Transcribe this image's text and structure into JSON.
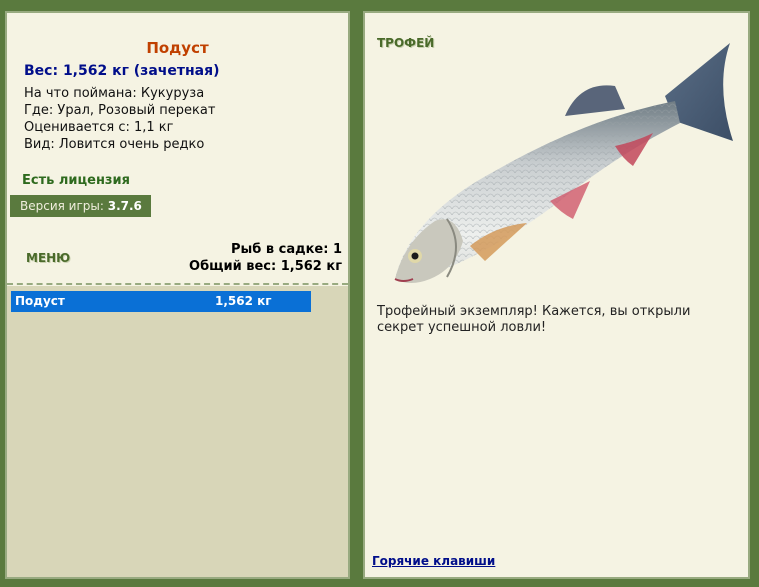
{
  "catch": {
    "fish_name": "Подуст",
    "weight_line": "Вес: 1,562 кг (зачетная)",
    "details": [
      "На что поймана: Кукуруза",
      "Где: Урал, Розовый перекат",
      "Оценивается с: 1,1 кг",
      "Вид: Ловится очень редко"
    ]
  },
  "license": "Есть лицензия",
  "version": {
    "label": "Версия игры:",
    "value": "3.7.6"
  },
  "menu_label": "МЕНЮ",
  "cage": {
    "count_line": "Рыб в садке: 1",
    "total_line": "Общий вес: 1,562 кг"
  },
  "cage_list": [
    {
      "name": "Подуст",
      "weight": "1,562 кг"
    }
  ],
  "trophy": {
    "title": "ТРОФЕЙ",
    "text": "Трофейный экземпляр! Кажется, вы открыли секрет успешной ловли!"
  },
  "hotkeys_link": "Горячие клавиши",
  "colors": {
    "frame": "#5a7a3e",
    "panel": "#f5f3e3",
    "list_bg": "#d8d6b8",
    "selected_row": "#0a70d6",
    "fish_name": "#c04000",
    "weight": "#000e8a",
    "license": "#2e6a1e"
  }
}
